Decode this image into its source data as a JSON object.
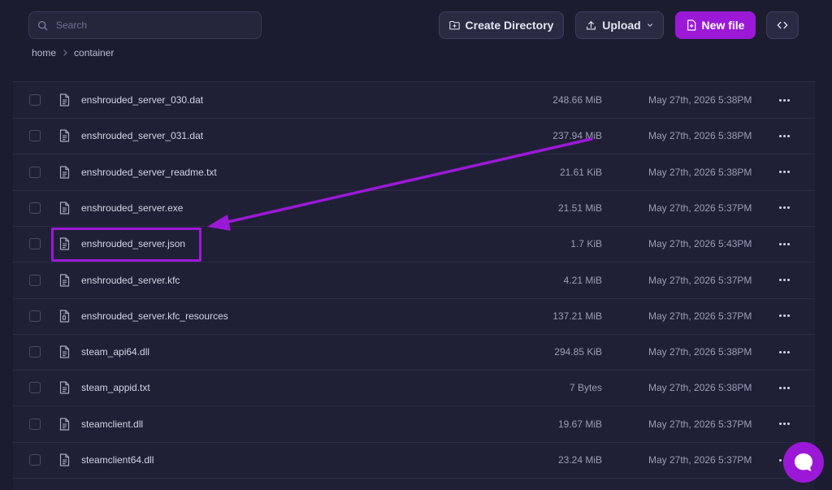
{
  "toolbar": {
    "search_placeholder": "Search",
    "create_directory_label": "Create Directory",
    "upload_label": "Upload",
    "new_file_label": "New file"
  },
  "breadcrumb": [
    "home",
    "container"
  ],
  "files": [
    {
      "name": "enshrouded_server_030.dat",
      "size": "248.66 MiB",
      "modified": "May 27th, 2026 5:38PM",
      "icon": "file-text-icon"
    },
    {
      "name": "enshrouded_server_031.dat",
      "size": "237.94 MiB",
      "modified": "May 27th, 2026 5:38PM",
      "icon": "file-text-icon"
    },
    {
      "name": "enshrouded_server_readme.txt",
      "size": "21.61 KiB",
      "modified": "May 27th, 2026 5:38PM",
      "icon": "file-text-icon"
    },
    {
      "name": "enshrouded_server.exe",
      "size": "21.51 MiB",
      "modified": "May 27th, 2026 5:37PM",
      "icon": "file-text-icon"
    },
    {
      "name": "enshrouded_server.json",
      "size": "1.7 KiB",
      "modified": "May 27th, 2026 5:43PM",
      "icon": "file-text-icon"
    },
    {
      "name": "enshrouded_server.kfc",
      "size": "4.21 MiB",
      "modified": "May 27th, 2026 5:37PM",
      "icon": "file-text-icon"
    },
    {
      "name": "enshrouded_server.kfc_resources",
      "size": "137.21 MiB",
      "modified": "May 27th, 2026 5:37PM",
      "icon": "file-archive-icon"
    },
    {
      "name": "steam_api64.dll",
      "size": "294.85 KiB",
      "modified": "May 27th, 2026 5:38PM",
      "icon": "file-text-icon"
    },
    {
      "name": "steam_appid.txt",
      "size": "7 Bytes",
      "modified": "May 27th, 2026 5:38PM",
      "icon": "file-text-icon"
    },
    {
      "name": "steamclient.dll",
      "size": "19.67 MiB",
      "modified": "May 27th, 2026 5:37PM",
      "icon": "file-text-icon"
    },
    {
      "name": "steamclient64.dll",
      "size": "23.24 MiB",
      "modified": "May 27th, 2026 5:37PM",
      "icon": "file-text-icon"
    }
  ],
  "annotation": {
    "highlighted_file": "enshrouded_server.json",
    "color": "#9b19d6"
  },
  "colors": {
    "accent": "#9b19d6",
    "background": "#1f2035"
  }
}
